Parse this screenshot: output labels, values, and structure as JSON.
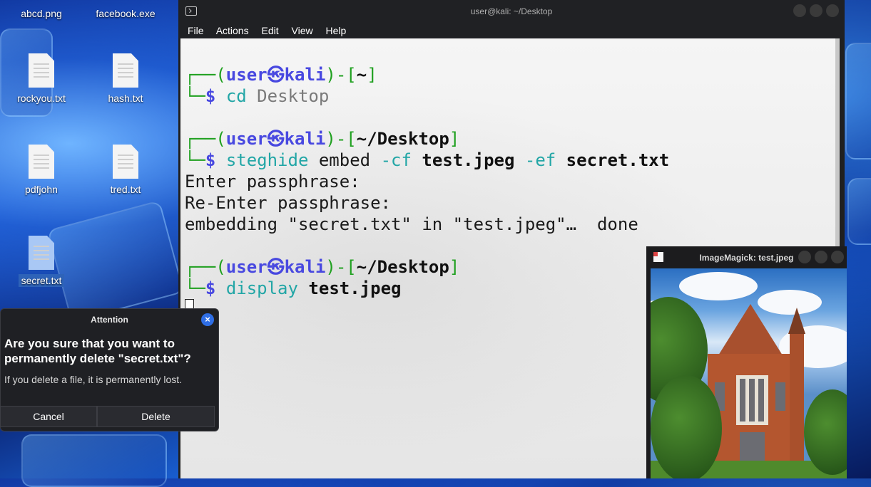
{
  "desktop": {
    "icons": [
      {
        "label": "abcd.png"
      },
      {
        "label": "facebook.exe"
      },
      {
        "label": "rockyou.txt"
      },
      {
        "label": "hash.txt"
      },
      {
        "label": "pdfjohn"
      },
      {
        "label": "tred.txt"
      },
      {
        "label": "secret.txt"
      }
    ]
  },
  "terminal": {
    "title": "user@kali: ~/Desktop",
    "menu": [
      "File",
      "Actions",
      "Edit",
      "View",
      "Help"
    ],
    "prompt": {
      "open": "┌──(",
      "user": "user",
      "at": "㉿",
      "host": "kali",
      "mid": ")-[",
      "close": "]",
      "dollar_prefix": "└─",
      "dollar": "$"
    },
    "blocks": [
      {
        "dir": "~",
        "cmd": "cd",
        "args": [
          {
            "text": " Desktop",
            "style": "gr"
          }
        ]
      },
      {
        "dir": "~/Desktop",
        "cmd": "steghide",
        "args": [
          {
            "text": " embed ",
            "style": "n"
          },
          {
            "text": "-cf",
            "style": "c"
          },
          {
            "text": " test.jpeg ",
            "style": "k"
          },
          {
            "text": "-ef",
            "style": "c"
          },
          {
            "text": " secret.txt",
            "style": "k"
          }
        ]
      },
      {
        "dir": "~/Desktop",
        "cmd": "display",
        "args": [
          {
            "text": " test.jpeg",
            "style": "k"
          }
        ]
      }
    ],
    "output": [
      "Enter passphrase:",
      "Re-Enter passphrase:",
      "embedding \"secret.txt\" in \"test.jpeg\"…  done"
    ]
  },
  "dialog": {
    "title": "Attention",
    "close_icon": "×",
    "heading": "Are you sure that you want to permanently delete \"secret.txt\"?",
    "message": "If you delete a file, it is permanently lost.",
    "cancel": "Cancel",
    "delete": "Delete"
  },
  "imagemagick": {
    "title": "ImageMagick: test.jpeg"
  }
}
